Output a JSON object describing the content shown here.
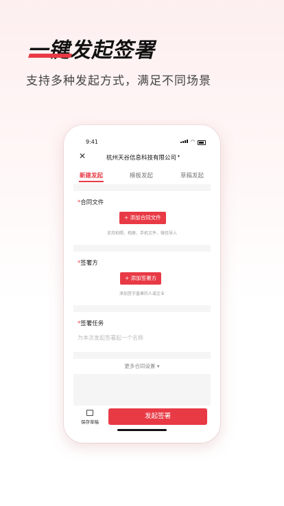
{
  "hero": {
    "title": "一键发起签署",
    "subtitle": "支持多种发起方式，满足不同场景"
  },
  "colors": {
    "accent": "#e83a45"
  },
  "status_bar": {
    "time": "9:41"
  },
  "nav": {
    "close_icon": "close-icon",
    "company": "杭州天谷信息科技有限公司",
    "dropdown_icon": "▾"
  },
  "tabs": [
    {
      "label": "新建发起",
      "active": true
    },
    {
      "label": "模板发起",
      "active": false
    },
    {
      "label": "草稿发起",
      "active": false
    }
  ],
  "sections": {
    "contract": {
      "required": "*",
      "label": "合同文件",
      "button": "+ 添加合同文件",
      "hint": "支持拍照、相册、手机文件、微信导入"
    },
    "signer": {
      "required": "*",
      "label": "签署方",
      "button": "+ 添加签署方",
      "hint": "添加签字盖章的人或企业"
    },
    "task": {
      "required": "*",
      "label": "签署任务",
      "placeholder": "为本次发起签署起一个名称"
    }
  },
  "more_settings": "更多合同设置 ▾",
  "bottom_bar": {
    "save_draft": "保存草稿",
    "submit": "发起签署"
  }
}
